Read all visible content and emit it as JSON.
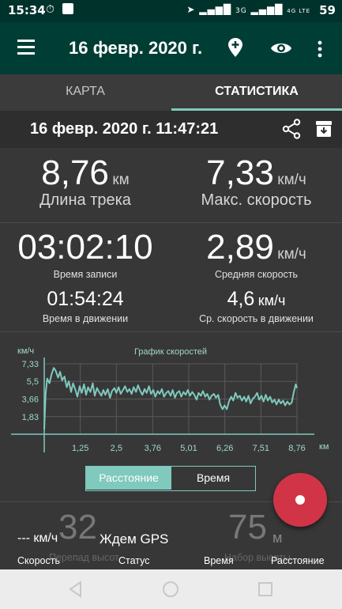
{
  "status_bar": {
    "time": "15:34",
    "network_left": "3G",
    "network_right": "4G LTE",
    "battery": "59"
  },
  "app_bar": {
    "title": "16 февр. 2020 г. 11:47:21"
  },
  "tabs": [
    {
      "label": "КАРТА"
    },
    {
      "label": "СТАТИСТИКА"
    }
  ],
  "track": {
    "datetime": "16 февр. 2020 г. 11:47:21"
  },
  "stats": {
    "track_length": {
      "value": "8,76",
      "unit": "км",
      "label": "Длина трека"
    },
    "max_speed": {
      "value": "7,33",
      "unit": "км/ч",
      "label": "Макс. скорость"
    },
    "record_time": {
      "value": "03:02:10",
      "label": "Время записи"
    },
    "avg_speed": {
      "value": "2,89",
      "unit": "км/ч",
      "label": "Средняя скорость"
    },
    "moving_time": {
      "value": "01:54:24",
      "label": "Время в движении"
    },
    "avg_moving_speed": {
      "value": "4,6",
      "unit": "км/ч",
      "label": "Ср. скорость в движении"
    }
  },
  "chart_data": {
    "type": "line",
    "title": "График скоростей",
    "ylabel": "км/ч",
    "xlabel": "км",
    "y_ticks": [
      "7,33",
      "5,5",
      "3,66",
      "1,83"
    ],
    "x_ticks": [
      "1,25",
      "2,5",
      "3,76",
      "5,01",
      "6,26",
      "7,51",
      "8,76"
    ],
    "xlim": [
      0,
      8.76
    ],
    "ylim": [
      0,
      7.33
    ],
    "grid": true,
    "series": [
      {
        "x": [
          0,
          0.05,
          0.1,
          0.18,
          0.26,
          0.33,
          0.4,
          0.48,
          0.55,
          0.62,
          0.7,
          0.78,
          0.85,
          0.93,
          1.0,
          1.08,
          1.15,
          1.23,
          1.3,
          1.38,
          1.45,
          1.52,
          1.6,
          1.68,
          1.75,
          1.83,
          1.9,
          1.98,
          2.05,
          2.12,
          2.2,
          2.28,
          2.35,
          2.43,
          2.5,
          2.58,
          2.65,
          2.73,
          2.8,
          2.88,
          2.95,
          3.03,
          3.1,
          3.18,
          3.25,
          3.33,
          3.4,
          3.48,
          3.55,
          3.63,
          3.7,
          3.78,
          3.85,
          3.93,
          4.0,
          4.08,
          4.15,
          4.23,
          4.3,
          4.38,
          4.45,
          4.53,
          4.6,
          4.68,
          4.75,
          4.83,
          4.9,
          4.98,
          5.05,
          5.13,
          5.2,
          5.28,
          5.35,
          5.43,
          5.5,
          5.58,
          5.65,
          5.73,
          5.8,
          5.88,
          5.95,
          6.03,
          6.1,
          6.18,
          6.25,
          6.33,
          6.4,
          6.48,
          6.55,
          6.63,
          6.7,
          6.78,
          6.85,
          6.93,
          7.0,
          7.08,
          7.15,
          7.23,
          7.3,
          7.38,
          7.45,
          7.53,
          7.6,
          7.68,
          7.75,
          7.83,
          7.9,
          7.98,
          8.05,
          8.13,
          8.2,
          8.28,
          8.35,
          8.43,
          8.5,
          8.58,
          8.65,
          8.72,
          8.76
        ],
        "y": [
          0.5,
          4.2,
          5.8,
          5.3,
          6.3,
          6.9,
          6.6,
          5.9,
          6.5,
          5.6,
          6.0,
          4.9,
          5.5,
          4.4,
          5.3,
          4.6,
          3.9,
          5.0,
          4.3,
          5.2,
          4.1,
          4.9,
          4.4,
          5.3,
          4.0,
          4.8,
          4.4,
          4.0,
          4.6,
          4.1,
          4.7,
          3.8,
          4.5,
          4.8,
          4.3,
          4.9,
          4.2,
          4.6,
          5.0,
          4.4,
          4.7,
          4.2,
          4.9,
          4.4,
          5.1,
          4.5,
          4.1,
          4.7,
          4.3,
          5.0,
          4.2,
          4.6,
          3.9,
          4.5,
          4.2,
          4.7,
          3.9,
          4.3,
          4.5,
          4.0,
          4.6,
          3.8,
          4.3,
          4.5,
          3.9,
          4.4,
          4.1,
          4.6,
          4.0,
          4.4,
          4.1,
          3.6,
          4.3,
          4.0,
          4.5,
          3.9,
          4.2,
          3.6,
          4.0,
          4.2,
          3.8,
          4.1,
          3.1,
          2.6,
          3.0,
          2.6,
          3.4,
          3.9,
          3.5,
          4.3,
          3.8,
          4.0,
          3.5,
          3.9,
          3.4,
          4.0,
          3.2,
          3.7,
          3.9,
          4.3,
          3.6,
          4.0,
          3.4,
          4.1,
          3.5,
          3.9,
          3.3,
          3.6,
          3.1,
          3.6,
          3.2,
          3.5,
          3.0,
          3.4,
          3.1,
          3.3,
          4.4,
          5.2,
          4.8
        ]
      }
    ]
  },
  "toggle": {
    "distance": "Расстояние",
    "time": "Время"
  },
  "bottom": {
    "speed": {
      "value": "--- км/ч",
      "label": "Скорость"
    },
    "elevation": {
      "value": "32",
      "label": "Перепад высот"
    },
    "status": {
      "value": "Ждем GPS",
      "label": "Статус"
    },
    "time": {
      "label": "Время"
    },
    "elev_gain": {
      "value": "75",
      "unit": "м",
      "label": "Набор высоты"
    },
    "distance": {
      "label": "Расстояние"
    }
  },
  "colors": {
    "appbar": "#003e35",
    "accent": "#7fc9bd",
    "fab": "#d13446",
    "chart_line": "#7fc9bd"
  }
}
